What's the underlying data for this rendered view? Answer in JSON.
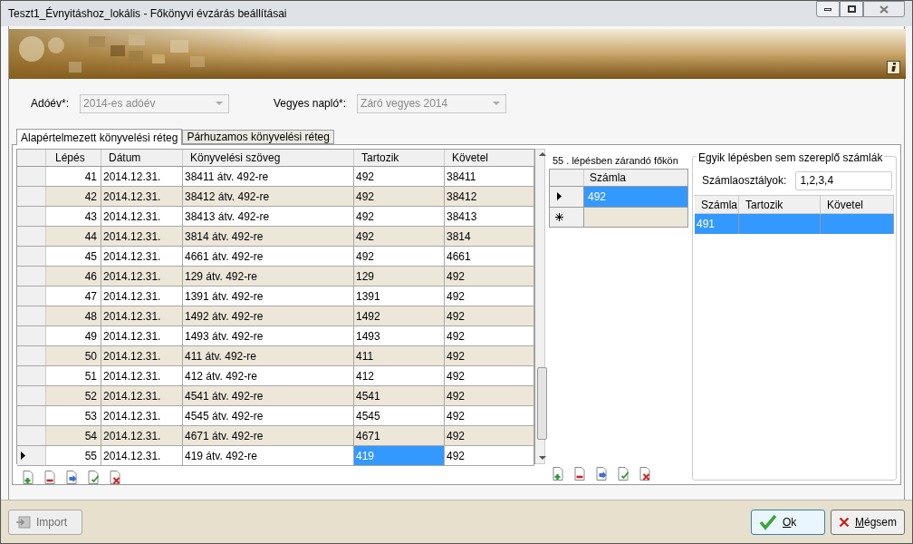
{
  "window": {
    "title": "Teszt1_Évnyitáshoz_lokális - Főkönyvi évzárás beállításai"
  },
  "filters": [
    {
      "label": "Adóév*:",
      "value": "2014-es adóév",
      "disabled": true
    },
    {
      "label": "Vegyes napló*:",
      "value": "Záró vegyes 2014",
      "disabled": true
    }
  ],
  "tabs": [
    {
      "label": "Alapértelmezett könyvelési réteg",
      "selected": true
    },
    {
      "label": "Párhuzamos könyvelési réteg",
      "selected": false
    }
  ],
  "steps_table": {
    "columns": [
      "Lépés",
      "Dátum",
      "Könyvelési szöveg",
      "Tartozik",
      "Követel"
    ],
    "rows": [
      {
        "cells": [
          "41",
          "2014.12.31.",
          "38411 átv. 492-re",
          "492",
          "38411"
        ],
        "selected": false,
        "tartozik_selected": false
      },
      {
        "cells": [
          "42",
          "2014.12.31.",
          "38412 átv. 492-re",
          "492",
          "38412"
        ],
        "selected": false,
        "tartozik_selected": false
      },
      {
        "cells": [
          "43",
          "2014.12.31.",
          "38413 átv. 492-re",
          "492",
          "38413"
        ],
        "selected": false,
        "tartozik_selected": false
      },
      {
        "cells": [
          "44",
          "2014.12.31.",
          "3814 átv. 492-re",
          "492",
          "3814"
        ],
        "selected": false,
        "tartozik_selected": false
      },
      {
        "cells": [
          "45",
          "2014.12.31.",
          "4661 átv. 492-re",
          "492",
          "4661"
        ],
        "selected": false,
        "tartozik_selected": false
      },
      {
        "cells": [
          "46",
          "2014.12.31.",
          "129 átv. 492-re",
          "129",
          "492"
        ],
        "selected": false,
        "tartozik_selected": false
      },
      {
        "cells": [
          "47",
          "2014.12.31.",
          "1391 átv. 492-re",
          "1391",
          "492"
        ],
        "selected": false,
        "tartozik_selected": false
      },
      {
        "cells": [
          "48",
          "2014.12.31.",
          "1492 átv. 492-re",
          "1492",
          "492"
        ],
        "selected": false,
        "tartozik_selected": false
      },
      {
        "cells": [
          "49",
          "2014.12.31.",
          "1493 átv. 492-re",
          "1493",
          "492"
        ],
        "selected": false,
        "tartozik_selected": false
      },
      {
        "cells": [
          "50",
          "2014.12.31.",
          "411 átv. 492-re",
          "411",
          "492"
        ],
        "selected": false,
        "tartozik_selected": false
      },
      {
        "cells": [
          "51",
          "2014.12.31.",
          "412 átv. 492-re",
          "412",
          "492"
        ],
        "selected": false,
        "tartozik_selected": false
      },
      {
        "cells": [
          "52",
          "2014.12.31.",
          "4541 átv. 492-re",
          "4541",
          "492"
        ],
        "selected": false,
        "tartozik_selected": false
      },
      {
        "cells": [
          "53",
          "2014.12.31.",
          "4545 átv. 492-re",
          "4545",
          "492"
        ],
        "selected": false,
        "tartozik_selected": false
      },
      {
        "cells": [
          "54",
          "2014.12.31.",
          "4671 átv. 492-re",
          "4671",
          "492"
        ],
        "selected": false,
        "tartozik_selected": false
      },
      {
        "cells": [
          "55",
          "2014.12.31.",
          "419 átv. 492-re",
          "419",
          "492"
        ],
        "selected": true,
        "tartozik_selected": true
      }
    ]
  },
  "accounts_to_close": {
    "caption": "55 . lépésben zárandó főkön",
    "column": "Számla",
    "rows": [
      {
        "value": "492",
        "selected": true
      }
    ]
  },
  "unused_accounts": {
    "title": "Egyik lépésben sem szereplő számlák",
    "classes_label": "Számlaosztályok:",
    "classes_value": "1,2,3,4",
    "columns": [
      "Számla",
      "Tartozik",
      "Követel"
    ],
    "rows": [
      {
        "cells": [
          "491"
        ],
        "selected": true
      }
    ]
  },
  "buttons": [
    {
      "label": "Import",
      "kind": "import",
      "disabled": true
    },
    {
      "label": "Ok",
      "kind": "ok",
      "disabled": false
    },
    {
      "label": "Mégsem",
      "kind": "cancel",
      "disabled": false
    }
  ]
}
